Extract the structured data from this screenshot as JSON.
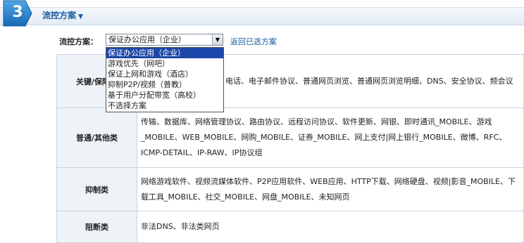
{
  "step": {
    "number": "3"
  },
  "section": {
    "title": "流控方案",
    "caret": "▼"
  },
  "plan": {
    "label": "流控方案：",
    "selected": "保证办公应用（企业）",
    "back_link": "返回已选方案",
    "options": [
      "保证办公应用（企业）",
      "游戏优先（网吧）",
      "保证上网和游戏（酒店）",
      "抑制P2P/视频（普教）",
      "基于用户分配带宽（高校）",
      "不选择方案"
    ]
  },
  "table": {
    "rows": [
      {
        "category": "关键/保障类",
        "content": "电话、电子邮件协议、普通网页浏览、普通网页浏览明细、DNS、安全协议、频会议"
      },
      {
        "category": "普通/其他类",
        "content": "传输、数据库、网络管理协议、路由协议、远程访问协议、软件更新、网银、即时通讯_MOBILE、游戏_MOBILE、WEB_MOBILE、网购_MOBILE、证券_MOBILE、网上支付|网上银行_MOBILE、微博、RFC、ICMP-DETAIL、IP-RAW、IP协议组"
      },
      {
        "category": "抑制类",
        "content": "网络游戏软件、视频流媒体软件、P2P应用软件、WEB应用、HTTP下载、网络硬盘、视频|影音_MOBILE、下载工具_MOBILE、社交_MOBILE、网盘_MOBILE、未知网页"
      },
      {
        "category": "阻断类",
        "content": "非法DNS、非法类网页"
      }
    ]
  },
  "colors": {
    "accent": "#1a5a9c",
    "badge": "#1f7fc6",
    "selection": "#1c46a8"
  }
}
